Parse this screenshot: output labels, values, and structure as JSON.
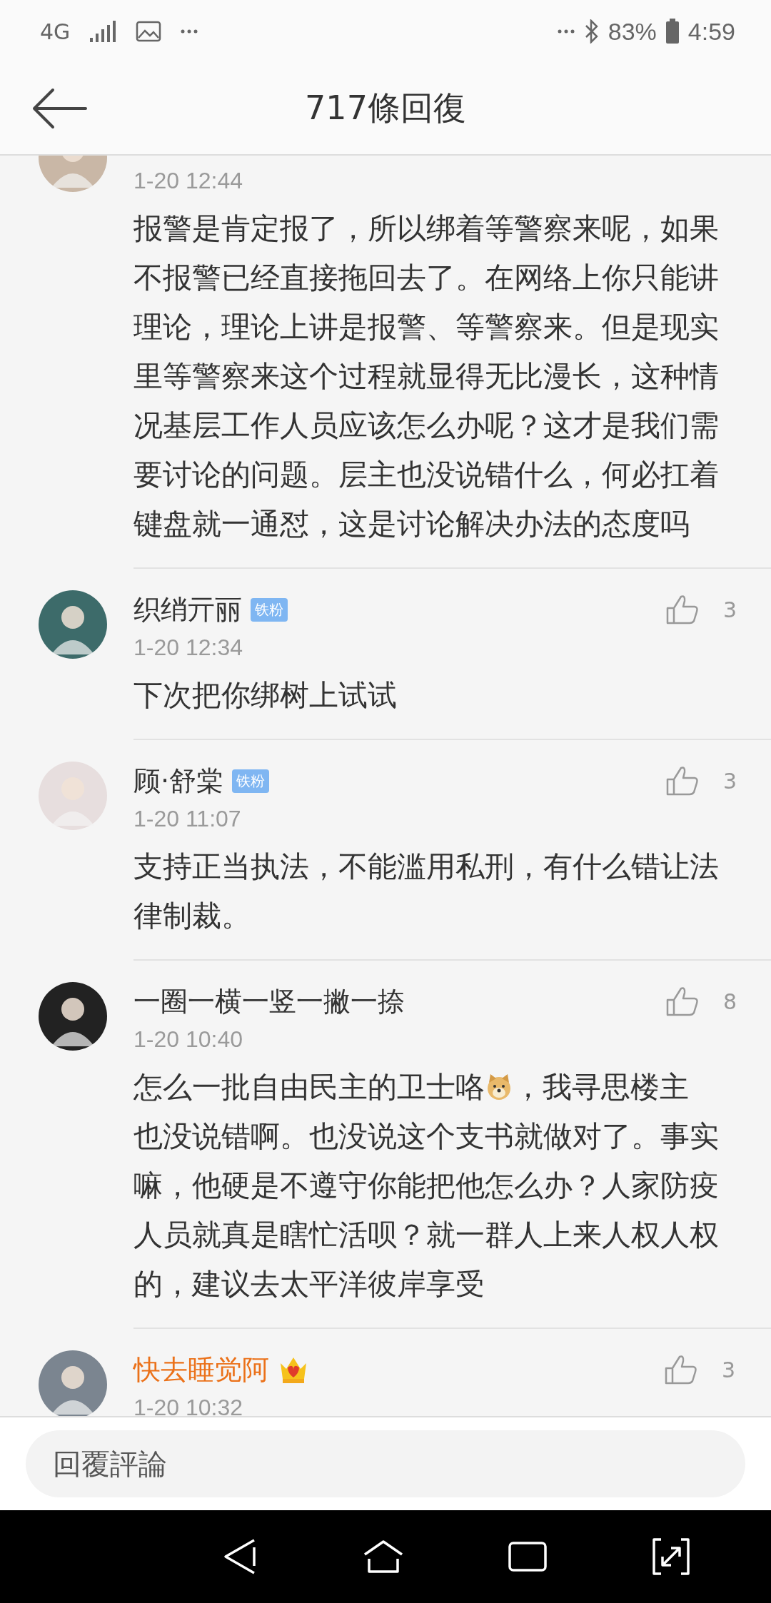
{
  "status_bar": {
    "network": "4G",
    "battery_percent": "83%",
    "time": "4:59"
  },
  "header": {
    "title": "717條回復"
  },
  "comments": [
    {
      "time": "1-20 12:44",
      "body": [
        {
          "kind": "text",
          "text": "报警是肯定报了，所以绑着等警察来呢，如果不报警已经直接拖回去了。在网络上你只能讲理论，理论上讲是报警、等警察来。但是现实里等警察来这个过程就显得无比漫长，这种情况基层工作人员应该怎么办呢？这才是我们需要讨论的问题。层主也没说错什么，何必扛着键盘就一通怼，这是讨论解决办法的态度吗"
        }
      ]
    },
    {
      "name": "织绡亓丽",
      "badge": "铁粉",
      "vip": false,
      "likes": "3",
      "time": "1-20 12:34",
      "body": [
        {
          "kind": "text",
          "text": "下次把你绑树上试试"
        }
      ]
    },
    {
      "name": "顾·舒棠",
      "badge": "铁粉",
      "vip": false,
      "likes": "3",
      "time": "1-20 11:07",
      "body": [
        {
          "kind": "text",
          "text": "支持正当执法，不能滥用私刑，有什么错让法律制裁。"
        }
      ]
    },
    {
      "name": "一圈一横一竖一撇一捺",
      "vip": false,
      "likes": "8",
      "time": "1-20 10:40",
      "body": [
        {
          "kind": "inline",
          "text": "怎么一批自由民主的卫士咯"
        },
        {
          "kind": "emoji"
        },
        {
          "kind": "inline",
          "text": "，我寻思楼主"
        },
        {
          "kind": "text",
          "text": "也没说错啊。也没说这个支书就做对了。事实嘛，他硬是不遵守你能把他怎么办？人家防疫人员就真是瞎忙活呗？就一群人上来人权人权的，建议去太平洋彼岸享受"
        }
      ]
    },
    {
      "name": "快去睡觉阿",
      "vip": true,
      "likes": "3",
      "time": "1-20 10:32"
    }
  ],
  "reply_bar": {
    "placeholder": "回覆評論"
  }
}
